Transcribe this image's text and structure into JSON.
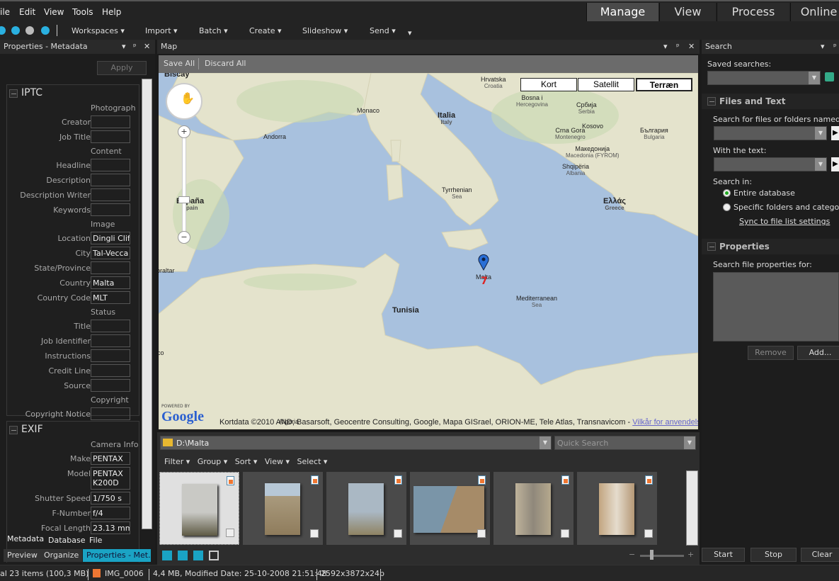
{
  "menu": [
    "ile",
    "Edit",
    "View",
    "Tools",
    "Help"
  ],
  "modes": [
    "Manage",
    "View",
    "Process",
    "Online"
  ],
  "toolbar": {
    "items": [
      "Workspaces",
      "Import",
      "Batch",
      "Create",
      "Slideshow",
      "Send"
    ]
  },
  "left_panel": {
    "title": "Properties - Metadata",
    "apply": "Apply",
    "iptc": {
      "title": "IPTC",
      "rows": [
        {
          "group": "Photograph"
        },
        {
          "label": "Creator",
          "value": ""
        },
        {
          "label": "Job Title",
          "value": ""
        },
        {
          "group": "Content"
        },
        {
          "label": "Headline",
          "value": ""
        },
        {
          "label": "Description",
          "value": ""
        },
        {
          "label": "Description Writer",
          "value": ""
        },
        {
          "label": "Keywords",
          "value": ""
        },
        {
          "group": "Image"
        },
        {
          "label": "Location",
          "value": "Dingli Cliffs"
        },
        {
          "label": "City",
          "value": "Tal-Vecca"
        },
        {
          "label": "State/Province",
          "value": ""
        },
        {
          "label": "Country",
          "value": "Malta"
        },
        {
          "label": "Country Code",
          "value": "MLT"
        },
        {
          "group": "Status"
        },
        {
          "label": "Title",
          "value": ""
        },
        {
          "label": "Job Identifier",
          "value": ""
        },
        {
          "label": "Instructions",
          "value": ""
        },
        {
          "label": "Credit Line",
          "value": ""
        },
        {
          "label": "Source",
          "value": ""
        },
        {
          "group": "Copyright"
        },
        {
          "label": "Copyright Notice",
          "value": ""
        }
      ]
    },
    "exif": {
      "title": "EXIF",
      "rows": [
        {
          "group": "Camera Info"
        },
        {
          "label": "Make",
          "value": "PENTAX"
        },
        {
          "label": "Model",
          "value": "PENTAX K200D",
          "tall": true
        },
        {
          "label": "Shutter Speed",
          "value": "1/750 s"
        },
        {
          "label": "F-Number",
          "value": "f/4"
        },
        {
          "label": "Focal Length",
          "value": "23.13 mm"
        }
      ]
    },
    "bottom_tabs": [
      "Metadata",
      "Database",
      "File"
    ],
    "workspace_tabs": [
      "Preview",
      "Organize",
      "Properties - Met..."
    ]
  },
  "map": {
    "title": "Map",
    "save_all": "Save All",
    "discard_all": "Discard All",
    "buttons": [
      "Kort",
      "Satellit",
      "Terræn"
    ],
    "labels": [
      {
        "t": "Biscay",
        "s": ""
      },
      {
        "t": "Hrvatska",
        "s": "Croatia"
      },
      {
        "t": "Bosna i",
        "s": "Hercegovina"
      },
      {
        "t": "Monaco",
        "s": ""
      },
      {
        "t": "Andorra",
        "s": ""
      },
      {
        "t": "Italia",
        "s": "Italy"
      },
      {
        "t": "Србија",
        "s": "Serbia"
      },
      {
        "t": "Kosovo",
        "s": ""
      },
      {
        "t": "Crna Gora",
        "s": "Montenegro"
      },
      {
        "t": "България",
        "s": "Bulgaria"
      },
      {
        "t": "Македонија",
        "s": "Macedonia (FYROM)"
      },
      {
        "t": "Shqipëria",
        "s": "Albania"
      },
      {
        "t": "Tyrrhenian",
        "s": "Sea"
      },
      {
        "t": "España",
        "s": "Spain"
      },
      {
        "t": "Ελλάς",
        "s": "Greece"
      },
      {
        "t": "Malta",
        "s": ""
      },
      {
        "t": "Mediterranean",
        "s": "Sea"
      },
      {
        "t": "Tunisia",
        "s": ""
      },
      {
        "t": "braltar",
        "s": ""
      },
      {
        "t": "co",
        "s": ""
      },
      {
        "t": "Algeria",
        "s": ""
      }
    ],
    "marker_count": "7",
    "powered_by": "POWERED BY",
    "logo": "Google",
    "attribution": "Kortdata ©2010 AND, Basarsoft, Geocentre Consulting, Google, Mapa GISrael, ORION-ME, Tele Atlas, Transnavicom - ",
    "terms_link": "Vilkår for anvendelse"
  },
  "browser": {
    "path": "D:\\Malta",
    "quick_search": "Quick Search",
    "menus": [
      "Filter",
      "Group",
      "Sort",
      "View",
      "Select"
    ]
  },
  "search": {
    "title": "Search",
    "saved_searches": "Saved searches:",
    "files_text": "Files and Text",
    "named": "Search for files or folders named:",
    "with_text": "With the text:",
    "search_in": "Search in:",
    "entire_db": "Entire database",
    "specific": "Specific folders and categories",
    "sync": "Sync to file list settings",
    "properties": "Properties",
    "props_for": "Search file properties for:",
    "remove": "Remove",
    "add": "Add...",
    "start": "Start",
    "stop": "Stop",
    "clear": "Clear"
  },
  "status": {
    "total": "al 23 items  (100,3 MB)",
    "file": "IMG_0006",
    "info": "4,4 MB, Modified Date: 25-10-2008 21:51:48",
    "dims": "2592x3872x24b"
  },
  "colors": {
    "sea": "#a8c1de",
    "land": "#e6e4cf",
    "accent": "#1aa3c4"
  }
}
